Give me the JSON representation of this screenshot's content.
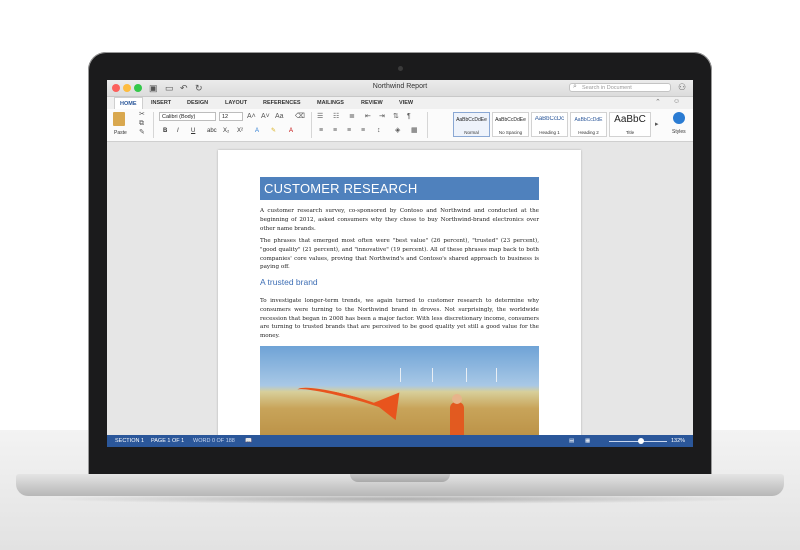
{
  "window": {
    "title": "Northwind Report",
    "search_placeholder": "Search in Document"
  },
  "tabs": [
    {
      "label": "HOME",
      "active": true
    },
    {
      "label": "INSERT"
    },
    {
      "label": "DESIGN"
    },
    {
      "label": "LAYOUT"
    },
    {
      "label": "REFERENCES"
    },
    {
      "label": "MAILINGS"
    },
    {
      "label": "REVIEW"
    },
    {
      "label": "VIEW"
    }
  ],
  "ribbon": {
    "paste_label": "Paste",
    "font_name": "Calibri (Body)",
    "font_size": "12",
    "bold": "B",
    "italic": "I",
    "underline": "U",
    "strike": "abc",
    "subscript": "X₂",
    "superscript": "X²",
    "styles_label": "Styles",
    "styles": [
      {
        "sample": "AaBbCcDdEe",
        "name": "Normal",
        "selected": true
      },
      {
        "sample": "AaBbCcDdEe",
        "name": "No Spacing"
      },
      {
        "sample": "AaBbCcDc",
        "name": "Heading 1"
      },
      {
        "sample": "AaBbCcDdE",
        "name": "Heading 2"
      },
      {
        "sample": "AaBbC",
        "name": "Title"
      }
    ]
  },
  "document": {
    "title": "CUSTOMER RESEARCH",
    "para1": "A customer research survey, co-sponsored by Contoso and Northwind and conducted at the beginning of 2012, asked consumers why they chose to buy Northwind-brand electronics over other name brands.",
    "para2": "The phrases that emerged most often were \"best value\" (26 percent), \"trusted\" (23 percent), \"good quality\" (21 percent), and \"innovative\" (19 percent). All of these phrases map back to both companies' core values, proving that Northwind's and Contoso's shared approach to business is paying off.",
    "heading": "A trusted brand",
    "para3": "To investigate longer-term trends, we again turned to customer research to determine why consumers were turning to the Northwind brand in droves. Not surprisingly, the worldwide recession that began in 2008 has been a major factor. With less discretionary income, consumers are turning to trusted brands that are perceived to be good quality yet still a good value for the money."
  },
  "status": {
    "section": "SECTION 1",
    "page": "PAGE 1 OF 1",
    "words": "WORD 0 OF 188",
    "zoom": "132%",
    "zoom_fraction": 0.55
  },
  "colors": {
    "accent": "#2b579a",
    "title_band": "#4f81bd",
    "heading": "#3f6fb5"
  }
}
